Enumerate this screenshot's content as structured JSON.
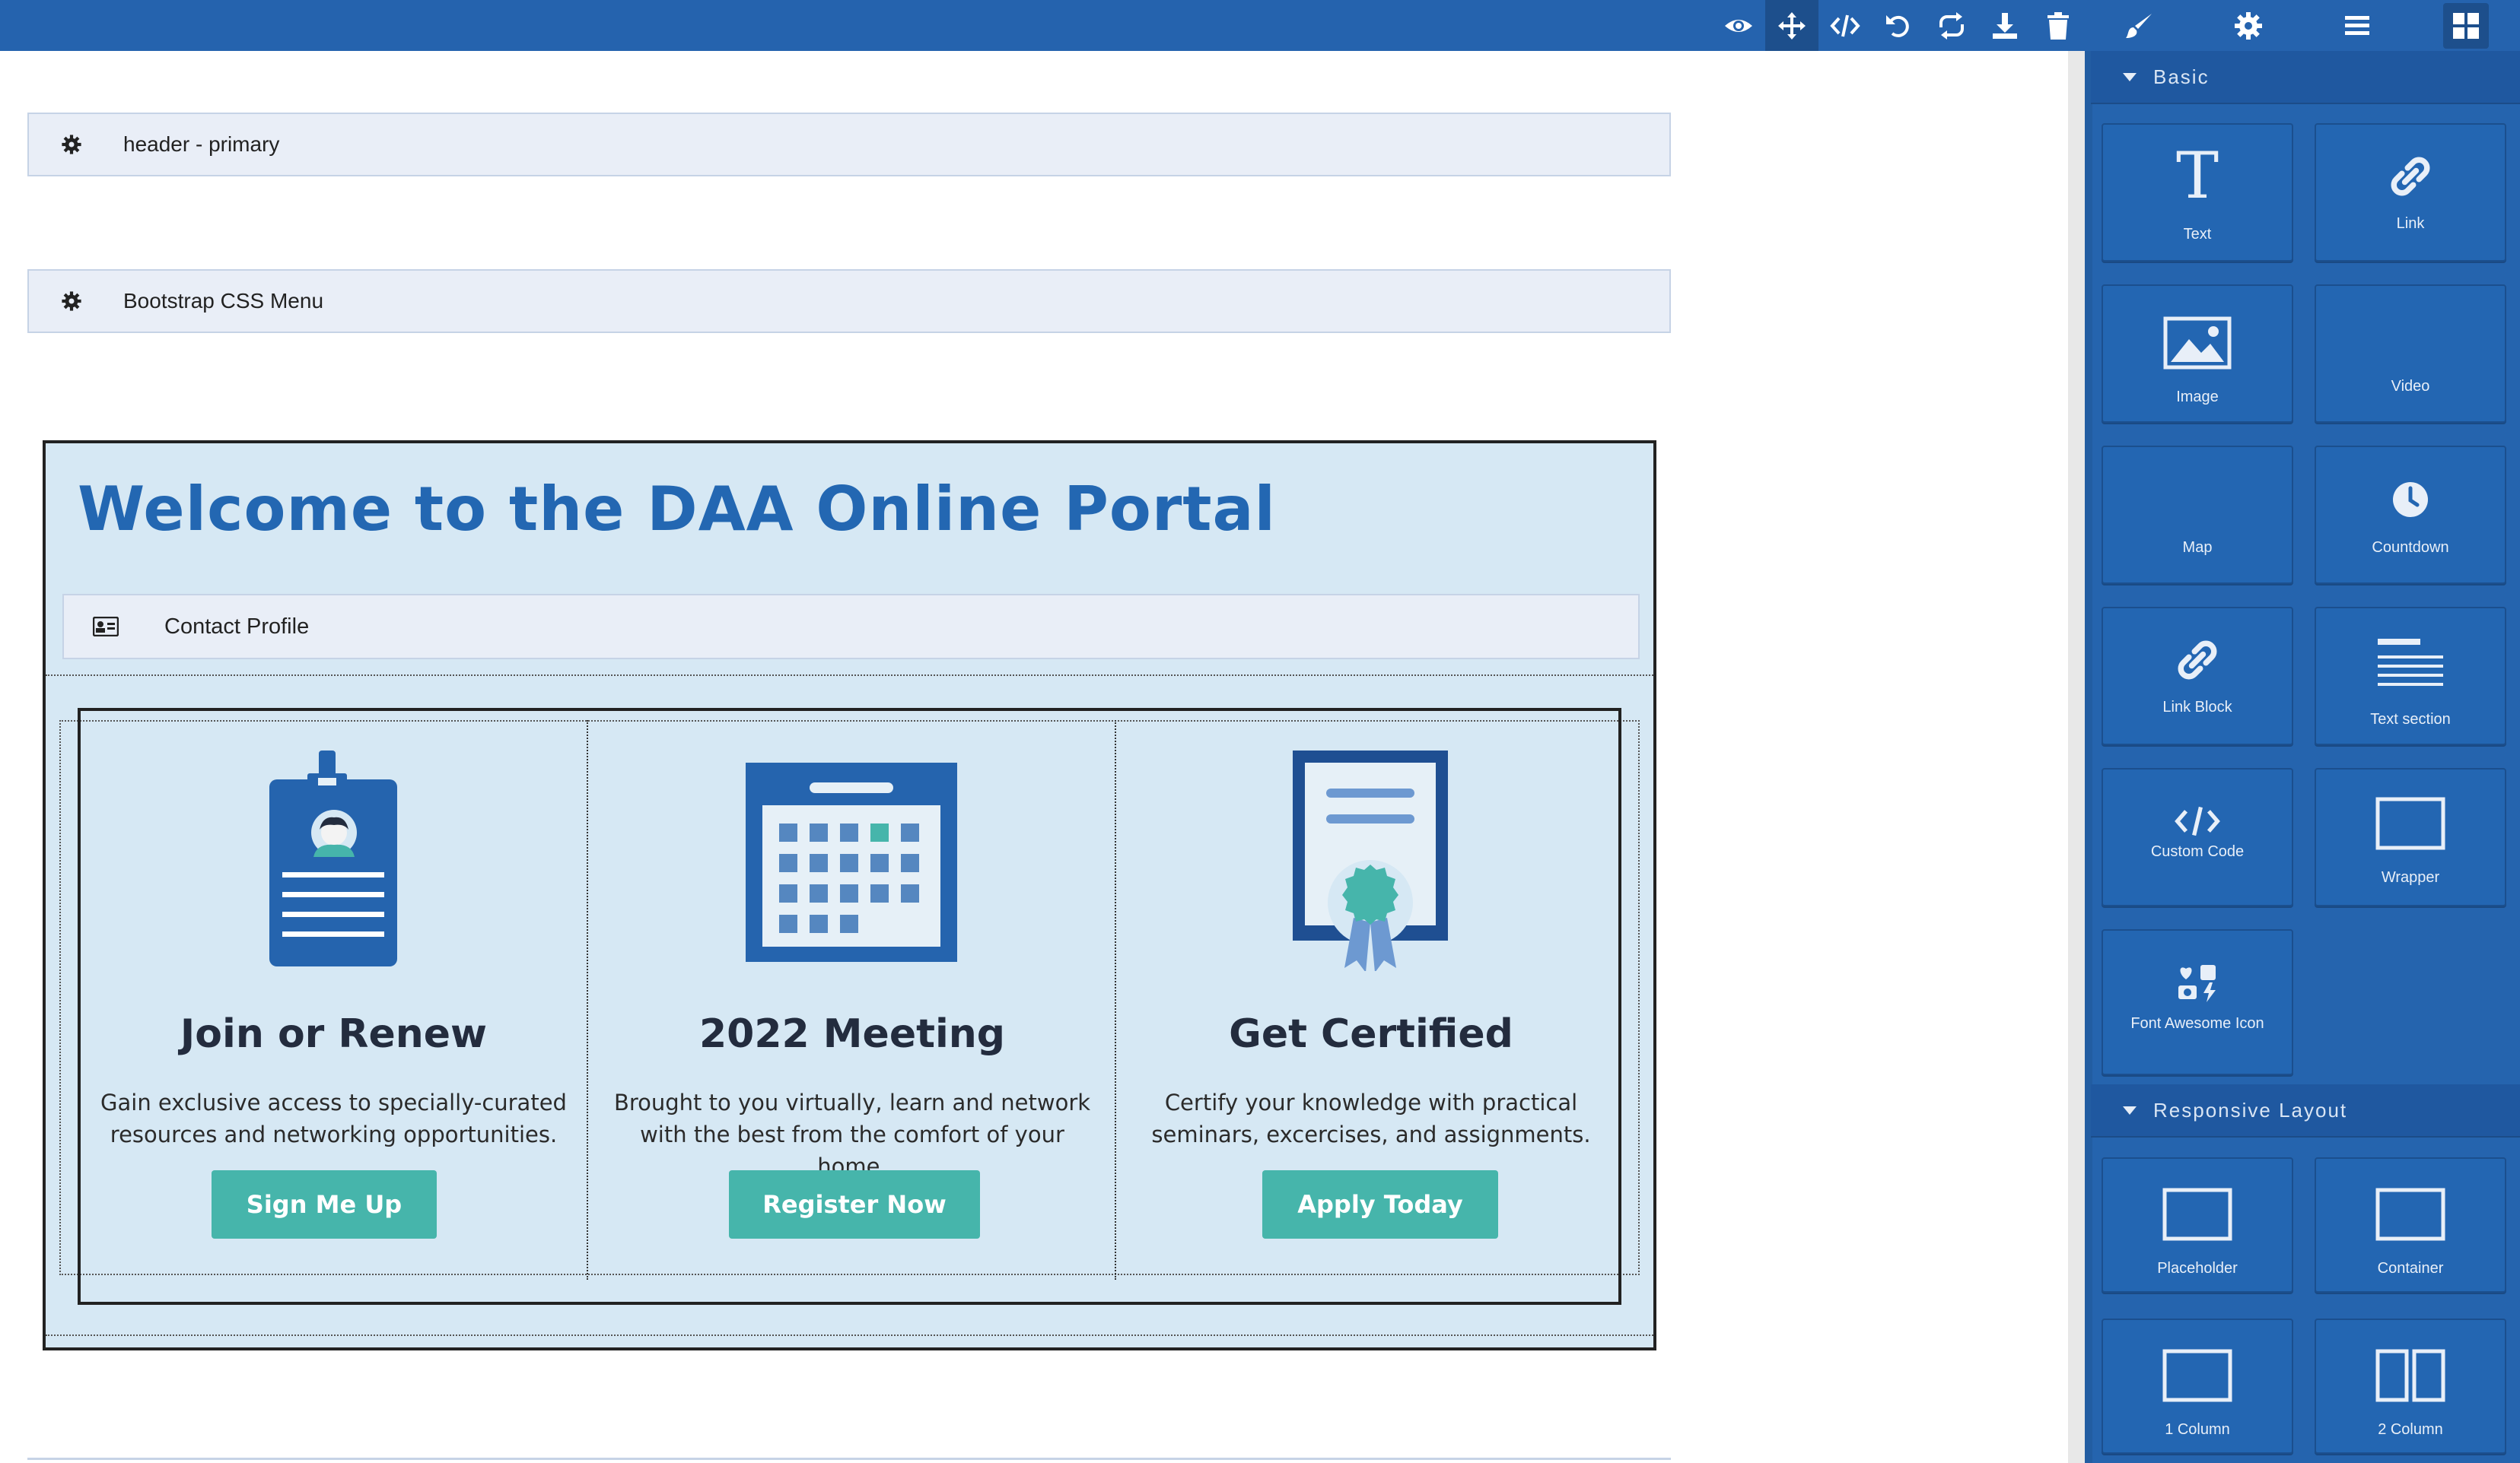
{
  "toolbar": {
    "actions": [
      "preview",
      "move",
      "code",
      "undo",
      "redo",
      "import",
      "delete"
    ],
    "panels": [
      "style-manager",
      "settings",
      "layers",
      "blocks"
    ]
  },
  "canvas": {
    "header_component": "header - primary",
    "menu_component": "Bootstrap CSS Menu",
    "hero": {
      "title": "Welcome to the DAA Online Portal",
      "contact_component": "Contact Profile",
      "cards": [
        {
          "title": "Join or Renew",
          "text": "Gain exclusive access to specially-curated resources and networking opportunities.",
          "button": "Sign Me Up",
          "icon": "id-badge-icon"
        },
        {
          "title": "2022 Meeting",
          "text": "Brought to you virtually, learn and network with the best from the comfort of your home.",
          "button": "Register Now",
          "icon": "calendar-icon"
        },
        {
          "title": "Get Certified",
          "text": "Certify your knowledge with practical seminars, excercises, and assignments.",
          "button": "Apply Today",
          "icon": "certificate-icon"
        }
      ]
    }
  },
  "blocks_panel": {
    "sections": [
      {
        "title": "Basic",
        "blocks": [
          "Text",
          "Link",
          "Image",
          "Video",
          "Map",
          "Countdown",
          "Link Block",
          "Text section",
          "Custom Code",
          "Wrapper",
          "Font Awesome Icon"
        ]
      },
      {
        "title": "Responsive Layout",
        "blocks": [
          "Placeholder",
          "Container",
          "1 Column",
          "2 Column"
        ]
      }
    ]
  },
  "colors": {
    "toolbar": "#2563ae",
    "panel": "#2564ae",
    "hero_bg": "#d6e8f4",
    "hero_title": "#2367b2",
    "button": "#46b5ab",
    "icon_blue": "#2564ae"
  }
}
